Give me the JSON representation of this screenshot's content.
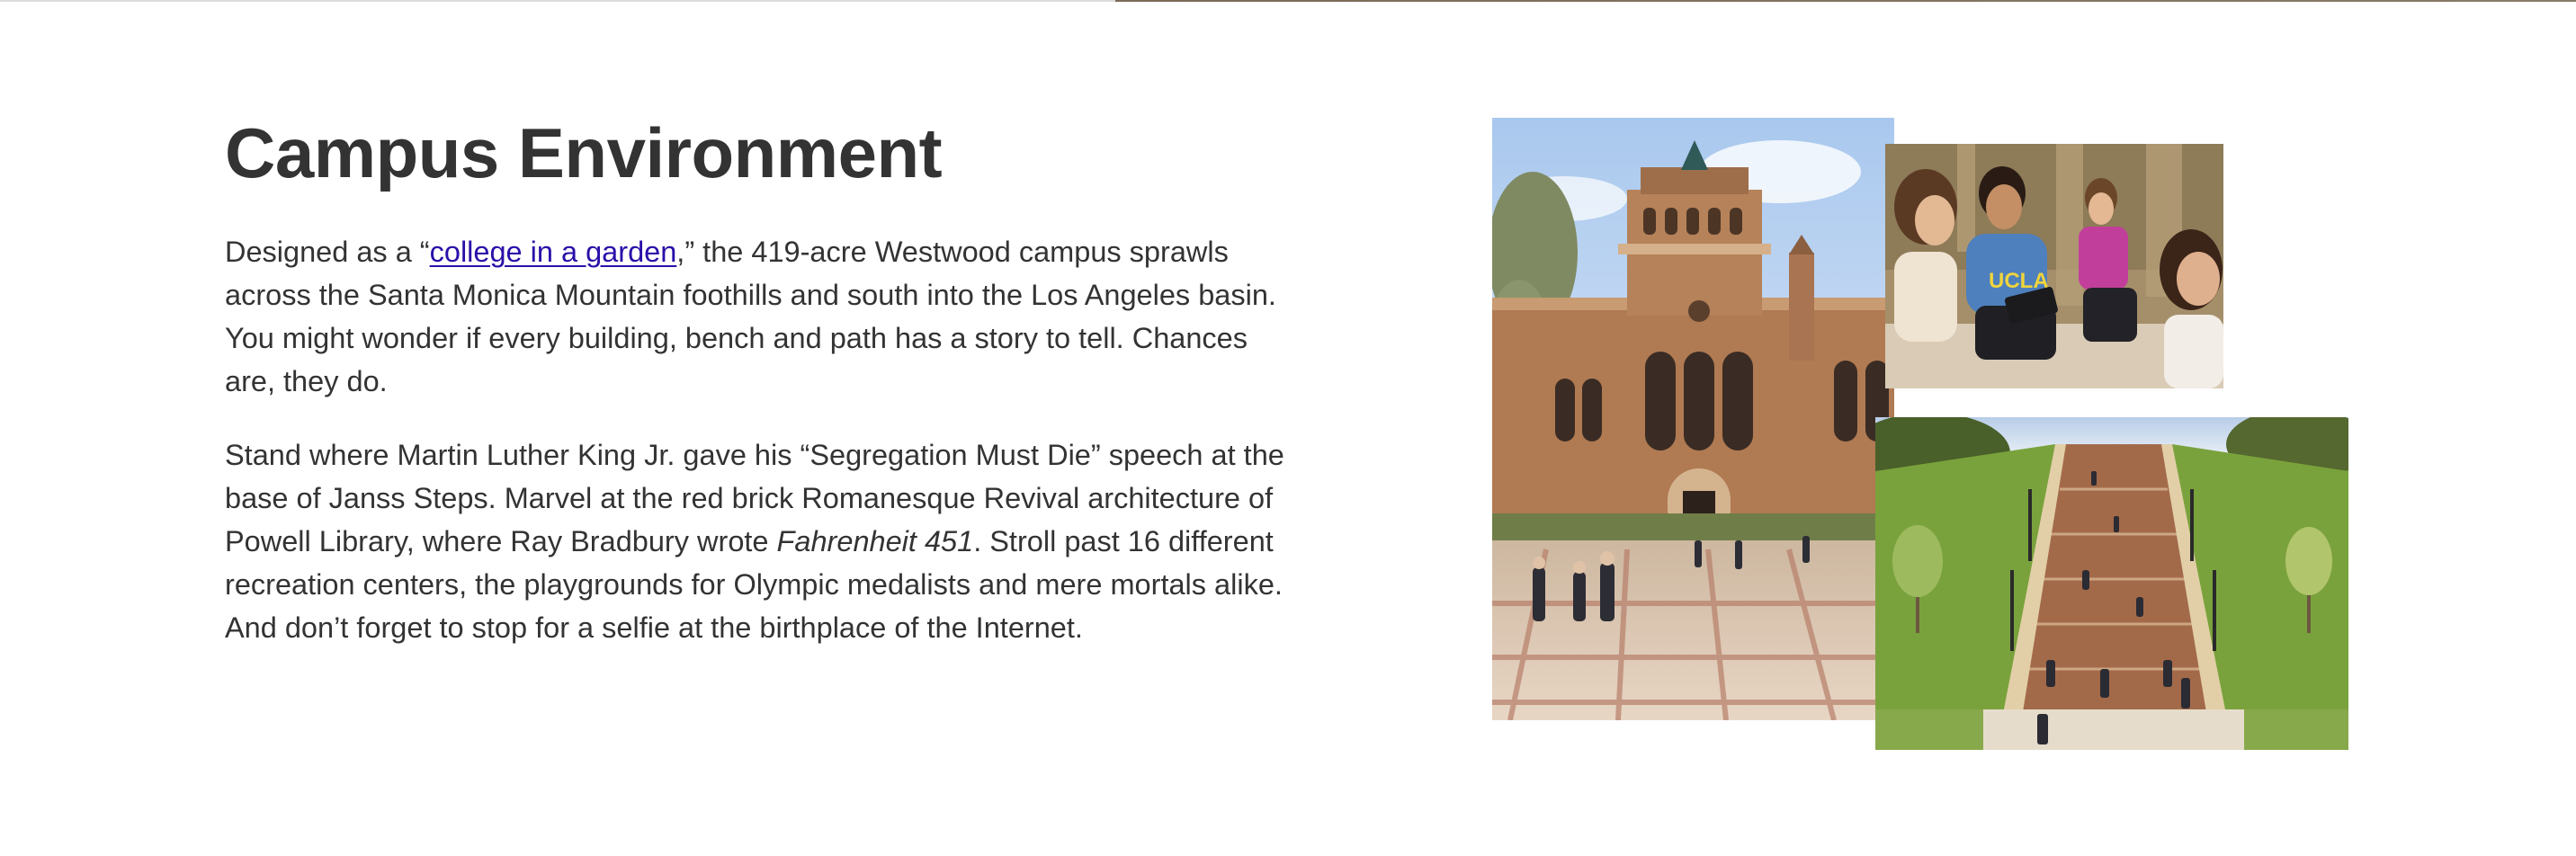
{
  "section": {
    "title": "Campus Environment"
  },
  "paragraph1": {
    "lead": "Designed as a “",
    "link_text": "college in a garden",
    "rest": ",” the 419-acre Westwood campus sprawls across the Santa Monica Mountain foothills and south into the Los Angeles basin. You might wonder if every building, bench and path has a story to tell. Chances are, they do."
  },
  "paragraph2": {
    "lead": "Stand where Martin Luther King Jr. gave his “Segregation Must Die” speech at the base of Janss Steps. Marvel at the red brick Romanesque Revival architecture of Powell Library, where Ray Bradbury wrote ",
    "book_title": "Fahrenheit 451",
    "rest": ". Stroll past 16 different recreation centers, the playgrounds for Olympic medalists and mere mortals alike. And don’t forget to stop for a selfie at the birthplace of the Internet."
  },
  "photos": {
    "library_shirt_text": "",
    "students_shirt_text": "UCLA"
  },
  "colors": {
    "text": "#333333",
    "link": "#2b0fa8",
    "brick": "#b07a52",
    "sky": "#c9dcf2",
    "grass": "#7aa23c"
  }
}
